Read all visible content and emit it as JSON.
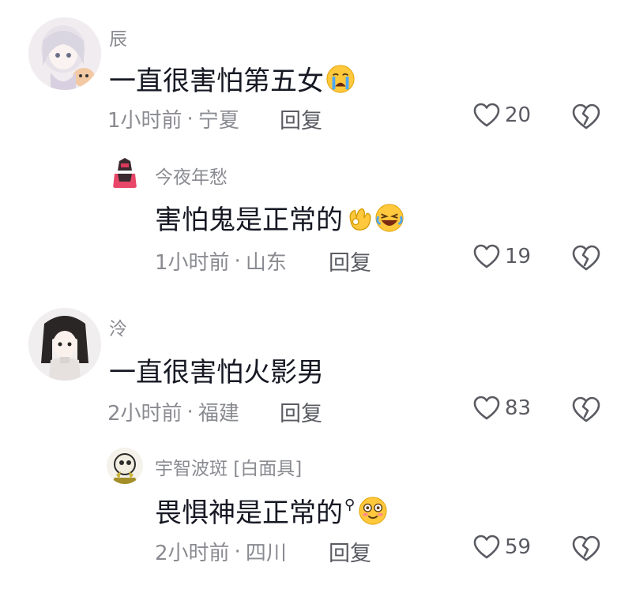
{
  "comments": [
    {
      "username": "辰",
      "text": "一直很害怕第五女",
      "emoji": "crying-face-emoji",
      "time": "1小时前",
      "location": "宁夏",
      "reply_label": "回复",
      "likes": "20"
    },
    {
      "username": "今夜年愁",
      "text": "害怕鬼是正常的",
      "emoji": "ok-hand-and-laughing-face-emoji",
      "time": "1小时前",
      "location": "山东",
      "reply_label": "回复",
      "likes": "19"
    },
    {
      "username": "泠",
      "text": "一直很害怕火影男",
      "time": "2小时前",
      "location": "福建",
      "reply_label": "回复",
      "likes": "83"
    },
    {
      "username": "宇智波斑 [白面具]",
      "text": "畏惧神是正常的",
      "emoji": "smiling-face-emoji",
      "time": "2小时前",
      "location": "四川",
      "reply_label": "回复",
      "likes": "59"
    }
  ],
  "colors": {
    "text": "#161823",
    "muted": "#8a8b91",
    "action": "#5a5b62"
  }
}
